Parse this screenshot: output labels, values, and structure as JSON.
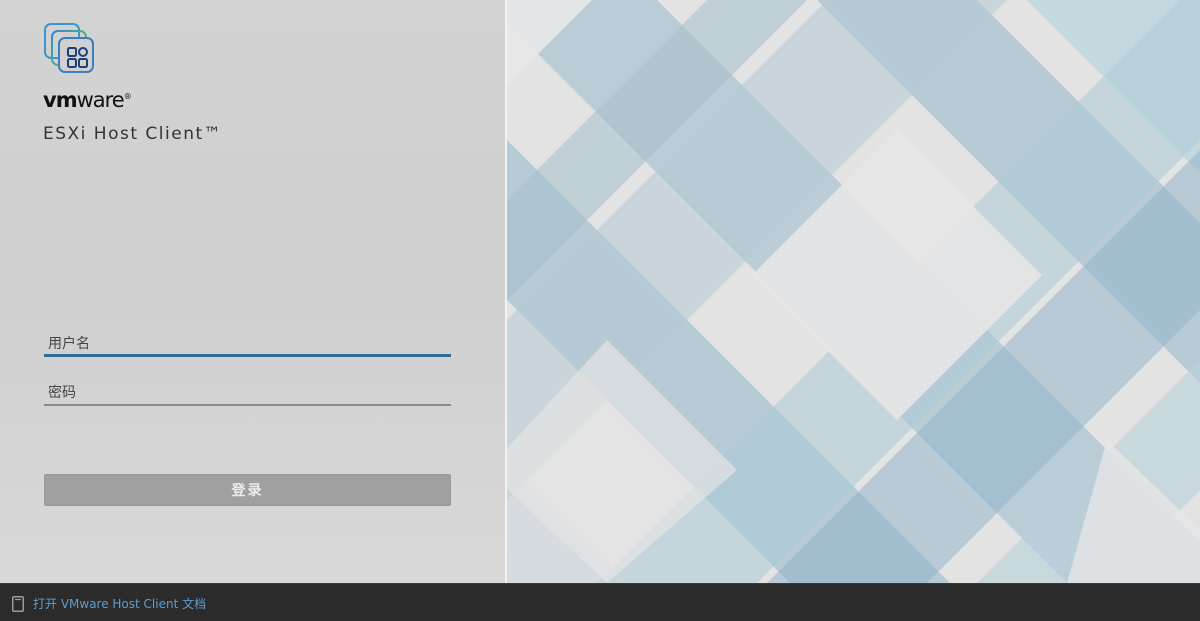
{
  "branding": {
    "logo_icon": "vmware-app-grid-icon",
    "wordmark_bold": "vm",
    "wordmark_regular": "ware",
    "wordmark_mark": "®",
    "product_name": "ESXi Host Client™"
  },
  "login_form": {
    "username_placeholder": "用户名",
    "username_value": "",
    "password_placeholder": "密码",
    "password_value": "",
    "login_button_label": "登录",
    "login_button_enabled": false
  },
  "footer": {
    "doc_icon": "document-icon",
    "doc_link_label": "打开 VMware Host Client 文档"
  },
  "colors": {
    "accent": "#2e6d9b",
    "link": "#5e9fd1",
    "footer_bg": "#2b2b2b",
    "button_disabled": "#a0a0a0"
  }
}
